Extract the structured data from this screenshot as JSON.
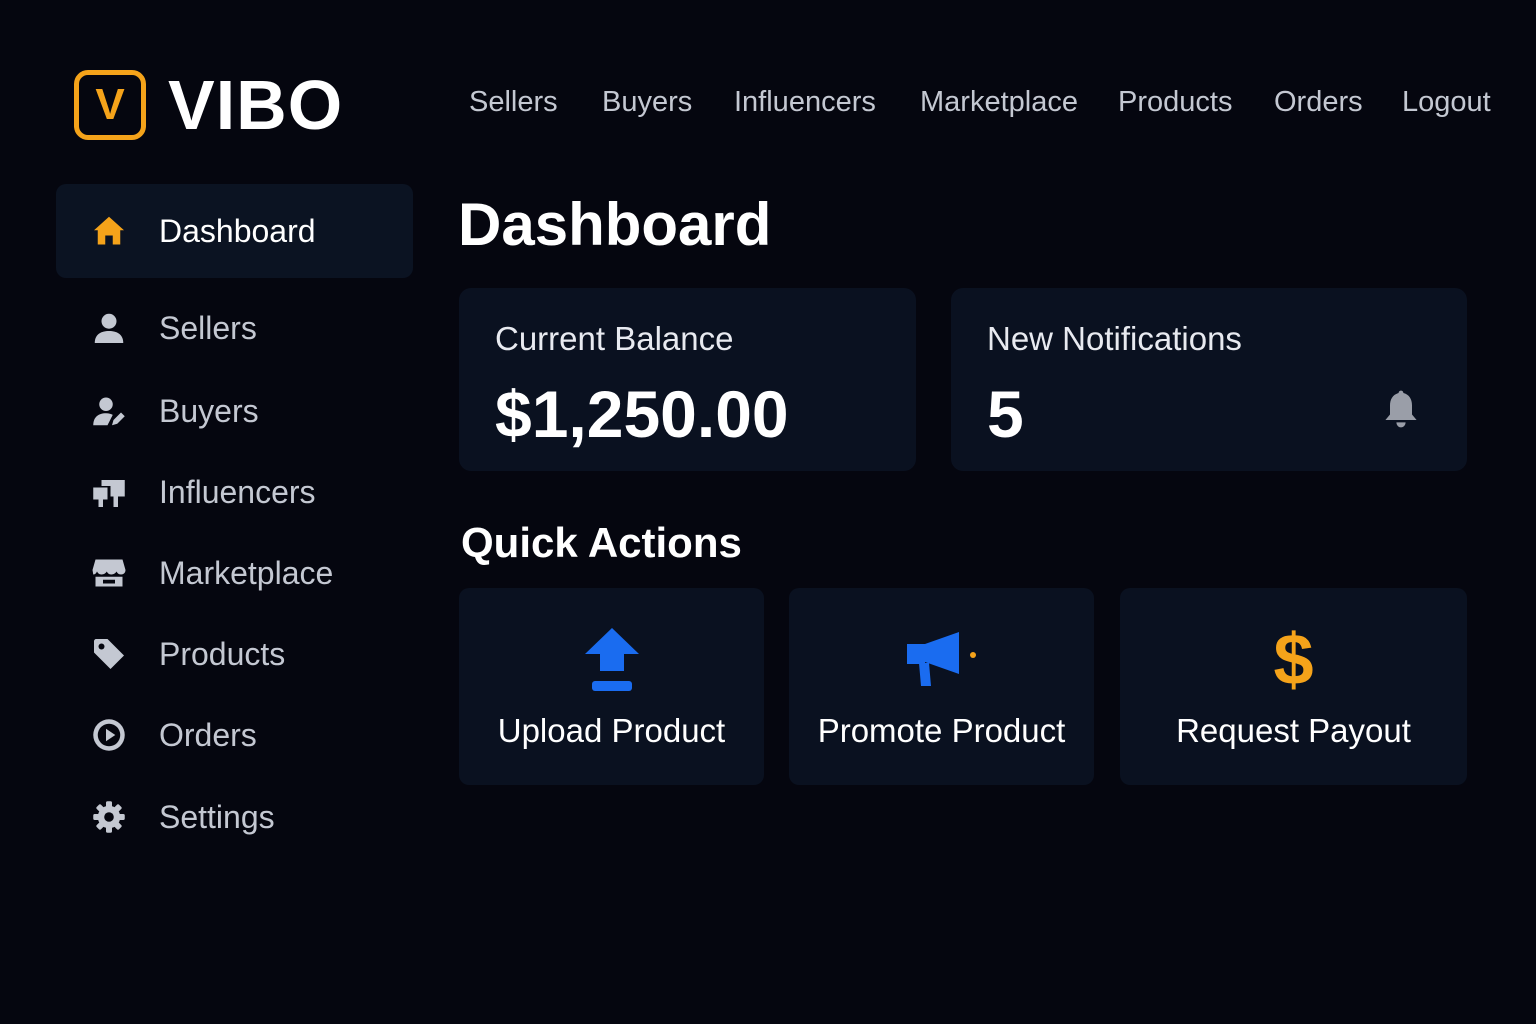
{
  "brand": {
    "letter": "V",
    "name": "VIBO",
    "accent": "#f5a31a"
  },
  "topnav": [
    "Sellers",
    "Buyers",
    "Influencers",
    "Marketplace",
    "Products",
    "Orders",
    "Logout"
  ],
  "sidebar": {
    "items": [
      {
        "label": "Dashboard",
        "icon": "home-icon",
        "active": true
      },
      {
        "label": "Sellers",
        "icon": "user-icon"
      },
      {
        "label": "Buyers",
        "icon": "user-edit-icon"
      },
      {
        "label": "Influencers",
        "icon": "mailbox-icon"
      },
      {
        "label": "Marketplace",
        "icon": "store-icon"
      },
      {
        "label": "Products",
        "icon": "tag-icon"
      },
      {
        "label": "Orders",
        "icon": "play-circle-icon"
      },
      {
        "label": "Settings",
        "icon": "gear-icon"
      }
    ]
  },
  "main": {
    "title": "Dashboard",
    "balance": {
      "label": "Current Balance",
      "value": "$1,250.00"
    },
    "notifications": {
      "label": "New Notifications",
      "value": "5",
      "icon": "bell-icon"
    },
    "quick_actions": {
      "title": "Quick Actions",
      "items": [
        {
          "label": "Upload Product",
          "icon": "upload-icon",
          "color": "#1a6cf0"
        },
        {
          "label": "Promote Product",
          "icon": "megaphone-icon",
          "color": "#1a6cf0"
        },
        {
          "label": "Request Payout",
          "icon": "dollar-icon",
          "color": "#f5a31a"
        }
      ]
    }
  }
}
